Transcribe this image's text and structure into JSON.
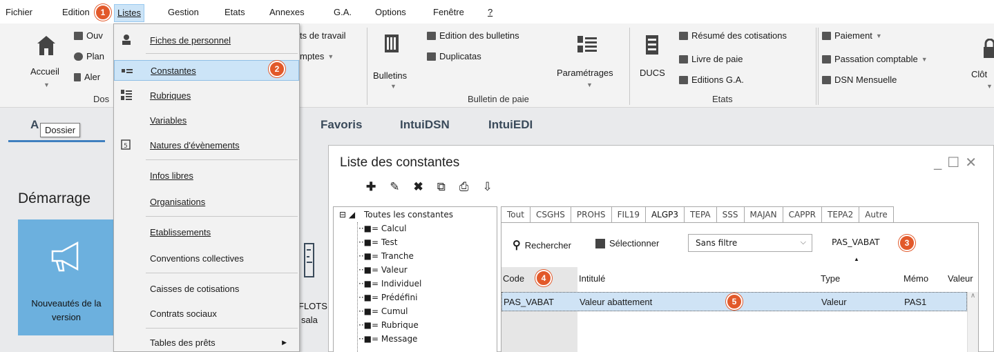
{
  "menubar": {
    "fichier": "Fichier",
    "edition": "Edition",
    "listes": "Listes",
    "gestion": "Gestion",
    "etats": "Etats",
    "annexes": "Annexes",
    "ga": "G.A.",
    "options": "Options",
    "fenetre": "Fenêtre",
    "help": "?"
  },
  "ribbon": {
    "accueil": "Accueil",
    "ouvrir_partial": "Ouv",
    "plan_partial": "Plan",
    "alert_partial": "Aler",
    "dossier_partial": "Dos",
    "ts_travail_partial": "ts de travail",
    "comptes_partial": "mptes",
    "edition_bulletins": "Edition des bulletins",
    "duplicatas": "Duplicatas",
    "bulletins": "Bulletins",
    "parametrages": "Paramétrages",
    "bulletin_de_paie": "Bulletin de paie",
    "ducs": "DUCS",
    "resume_cotisations": "Résumé des cotisations",
    "livre_de_paie": "Livre de paie",
    "editions_ga": "Editions G.A.",
    "etats": "Etats",
    "paiement": "Paiement",
    "passation_comptable": "Passation comptable",
    "dsn_mensuelle": "DSN Mensuelle",
    "cloture_partial": "Clôt"
  },
  "tabs_strip": {
    "accueil_partial": "A",
    "favoris": "Favoris",
    "intuidsn": "IntuiDSN",
    "intuiedi": "IntuiEDI"
  },
  "tooltip": "Dossier",
  "start": {
    "title": "Démarrage",
    "tile_line1": "Nouveautés de la",
    "tile_line2": "version",
    "flots_line1": "FLOTS",
    "flots_line2": "sala"
  },
  "dropdown": {
    "items": [
      {
        "label": "Fiches de personnel"
      },
      {
        "label": "Constantes"
      },
      {
        "label": "Rubriques"
      },
      {
        "label": "Variables"
      },
      {
        "label": "Natures d'évènements"
      },
      {
        "label": "Infos libres"
      },
      {
        "label": "Organisations"
      },
      {
        "label": "Etablissements"
      },
      {
        "label": "Conventions collectives"
      },
      {
        "label": "Caisses de cotisations"
      },
      {
        "label": "Contrats sociaux"
      },
      {
        "label": "Tables des prêts"
      }
    ]
  },
  "window": {
    "title": "Liste des constantes",
    "tree": {
      "root": "Toutes les constantes",
      "items": [
        "Calcul",
        "Test",
        "Tranche",
        "Valeur",
        "Individuel",
        "Prédéfini",
        "Cumul",
        "Rubrique",
        "Message"
      ]
    },
    "tabs": [
      "Tout",
      "CSGHS",
      "PROHS",
      "FIL19",
      "ALGP3",
      "TEPA",
      "SSS",
      "MAJAN",
      "CAPPR",
      "TEPA2",
      "Autre"
    ],
    "active_tab": "ALGP3",
    "rechercher": "Rechercher",
    "selectionner": "Sélectionner",
    "filter_value": "Sans filtre",
    "search_value": "PAS_VABAT",
    "columns": [
      "Code",
      "Intitulé",
      "Type",
      "Mémo",
      "Valeur"
    ],
    "rows": [
      {
        "code": "PAS_VABAT",
        "intitule": "Valeur abattement",
        "type": "Valeur",
        "memo": "PAS1",
        "valeur": ""
      }
    ]
  },
  "callouts": [
    "1",
    "2",
    "3",
    "4",
    "5"
  ],
  "colors": {
    "accent": "#3f7fbf",
    "callout": "#e2592a",
    "highlight": "#cce4f7",
    "tile": "#6cb0de"
  }
}
